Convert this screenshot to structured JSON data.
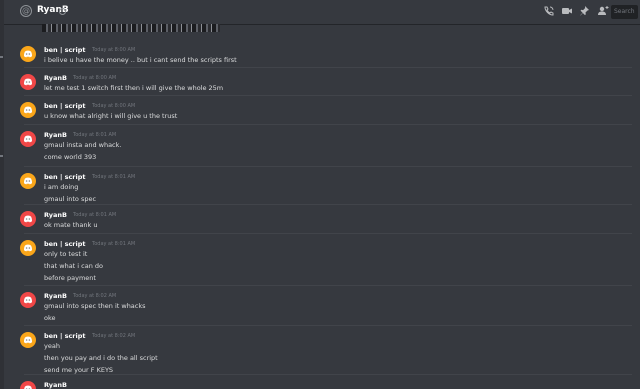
{
  "header": {
    "title": "RyanB",
    "search_placeholder": "Search"
  },
  "colors": {
    "background": "#36393f",
    "text": "#dcddde",
    "author": "#ffffff",
    "timestamp": "#72767d",
    "ben_avatar": "#faa61a",
    "ryan_avatar": "#f04747"
  },
  "icons": [
    "at-icon",
    "phone-call-icon",
    "video-call-icon",
    "pin-icon",
    "add-member-icon",
    "discord-logo-icon"
  ],
  "messages": [
    {
      "author": "ben | script",
      "avatar": "ben",
      "timestamp": "Today at 8:00 AM",
      "lines": [
        "i belive u have the money .. but i cant send the scripts first"
      ]
    },
    {
      "author": "RyanB",
      "avatar": "ryan",
      "timestamp": "Today at 8:00 AM",
      "lines": [
        "let me test 1 switch first then i will give the whole 25m"
      ]
    },
    {
      "author": "ben | script",
      "avatar": "ben",
      "timestamp": "Today at 8:00 AM",
      "lines": [
        "u know what alright  i will give u the trust"
      ]
    },
    {
      "author": "RyanB",
      "avatar": "ryan",
      "timestamp": "Today at 8:01 AM",
      "lines": [
        "gmaul insta and whack.",
        "come world 393"
      ]
    },
    {
      "author": "ben | script",
      "avatar": "ben",
      "timestamp": "Today at 8:01 AM",
      "lines": [
        "i am doing",
        "gmaul into spec"
      ]
    },
    {
      "author": "RyanB",
      "avatar": "ryan",
      "timestamp": "Today at 8:01 AM",
      "lines": [
        "ok mate thank u"
      ]
    },
    {
      "author": "ben | script",
      "avatar": "ben",
      "timestamp": "Today at 8:01 AM",
      "lines": [
        "only to test it",
        "that what i can do",
        "before payment"
      ]
    },
    {
      "author": "RyanB",
      "avatar": "ryan",
      "timestamp": "Today at 8:02 AM",
      "lines": [
        "gmaul into spec then it whacks",
        "oke"
      ]
    },
    {
      "author": "ben | script",
      "avatar": "ben",
      "timestamp": "Today at 8:02 AM",
      "lines": [
        "yeah",
        "then you pay and i do the all script",
        "send me your F KEYS"
      ]
    },
    {
      "author": "RyanB",
      "avatar": "ryan",
      "timestamp": "",
      "lines": []
    }
  ]
}
